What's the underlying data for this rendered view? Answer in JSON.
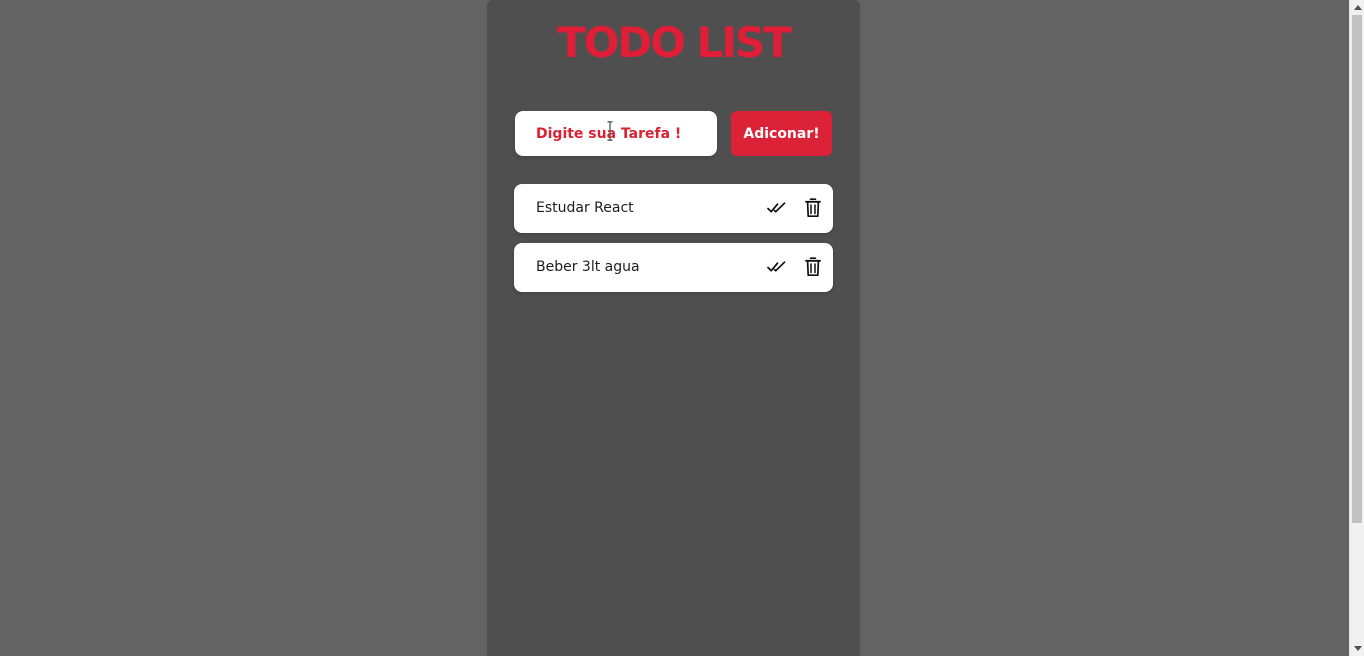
{
  "app": {
    "title": "TODO LIST"
  },
  "form": {
    "input_placeholder": "Digite sua Tarefa !",
    "input_value": "",
    "add_label": "Adiconar!"
  },
  "todos": [
    {
      "text": "Estudar React",
      "check_icon": "double-check-icon",
      "delete_icon": "trash-icon"
    },
    {
      "text": "Beber 3lt agua",
      "check_icon": "double-check-icon",
      "delete_icon": "trash-icon"
    }
  ],
  "colors": {
    "page_background": "#636363",
    "panel_background": "#4f4f4f",
    "accent_red": "#e01e37",
    "button_red": "#dc2236",
    "card_white": "#ffffff"
  }
}
